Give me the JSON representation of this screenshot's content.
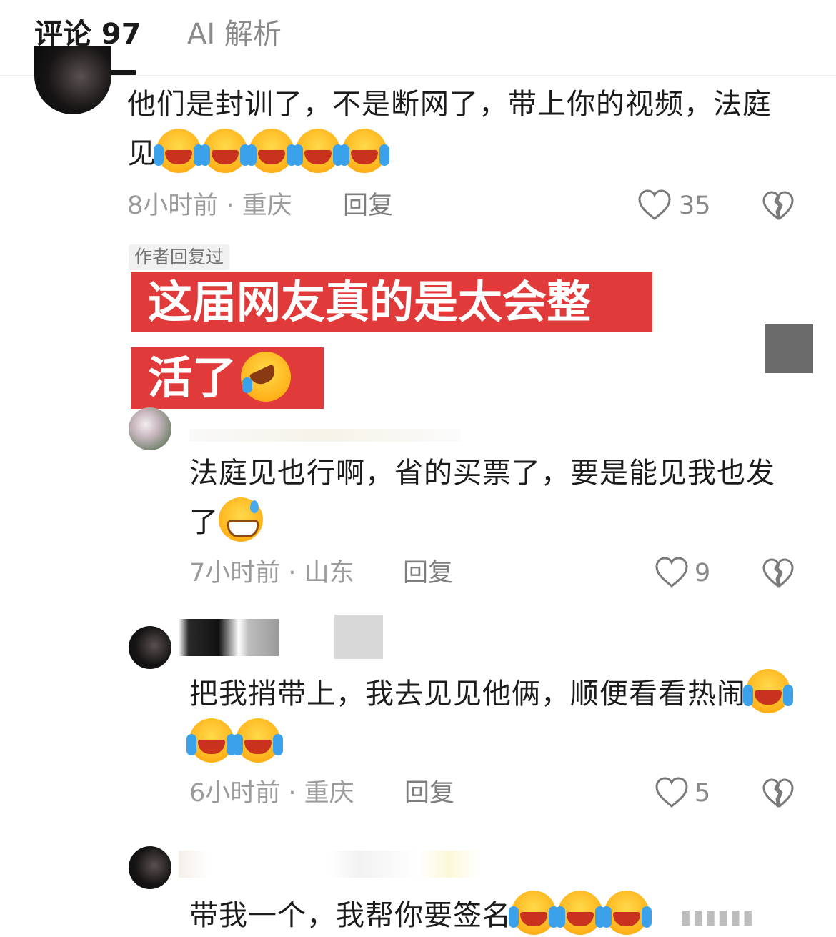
{
  "tabs": [
    {
      "label": "评论 97",
      "active": true
    },
    {
      "label": "AI 解析",
      "active": false
    }
  ],
  "comments": [
    {
      "text": "他们是封训了，不是断网了，带上你的视频，法庭见",
      "emojis": [
        "loudly-crying-face",
        "loudly-crying-face",
        "loudly-crying-face",
        "loudly-crying-face",
        "loudly-crying-face"
      ],
      "time": "8小时前 · 重庆",
      "reply_label": "回复",
      "likes": "35"
    },
    {
      "text": "法庭见也行啊，省的买票了，要是能见我也发了",
      "emojis": [
        "grinning-face-with-sweat"
      ],
      "time": "7小时前 · 山东",
      "reply_label": "回复",
      "likes": "9"
    },
    {
      "text": "把我捎带上，我去见见他俩，顺便看看热闹",
      "emojis": [
        "loudly-crying-face",
        "loudly-crying-face",
        "loudly-crying-face"
      ],
      "time": "6小时前 · 重庆",
      "reply_label": "回复",
      "likes": "5"
    },
    {
      "text": "带我一个，我帮你要签名",
      "emojis": [
        "loudly-crying-face",
        "loudly-crying-face",
        "loudly-crying-face"
      ]
    }
  ],
  "author_badge": "作者回复过",
  "overlay": {
    "line1": "这届网友真的是太会整",
    "line2": "活了",
    "emoji": "rolling-on-the-floor-laughing"
  },
  "icons": {
    "like": "heart-outline-icon",
    "dislike": "broken-heart-icon"
  },
  "colors": {
    "overlay_red": "#e13a3a",
    "meta_grey": "#9b9b9b",
    "text": "#1c1c1c"
  }
}
